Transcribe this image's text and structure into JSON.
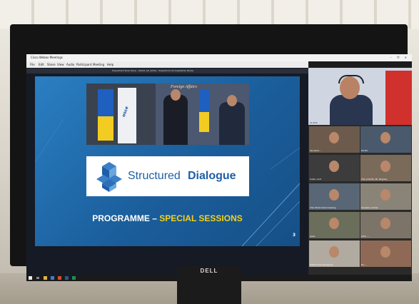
{
  "window": {
    "title": "Cisco Webex Meetings",
    "menu": [
      "File",
      "Edit",
      "Share",
      "View",
      "Audio",
      "Participant",
      "Meeting",
      "Help"
    ]
  },
  "presentation_window_title": "PowerPoint Slide Show - [OSCE_SD_2020] - PowerPoint (Compatibility Mode)",
  "slide": {
    "photo_caption": "Foreign Affairs",
    "logo_text_1": "Structured",
    "logo_text_2": "Dialogue",
    "footer_part1": "PROGRAMME – ",
    "footer_part2": "SPECIAL SESSIONS",
    "page_number": "3",
    "osce_text": "osce"
  },
  "video_panel": {
    "main_label": "AL-EUS",
    "tiles": [
      "Yes-Yeah...",
      "EU-EU",
      "Cuba, Lord",
      "USA (OSCE), Mr. Bogdan",
      "USA Strait-stand Galang",
      "Slovakia, Sorter",
      "Lada",
      "Adm. ...",
      "OSCE Joint Senuleries",
      "Hu..."
    ]
  },
  "monitor_brand": "DELL",
  "colors": {
    "slide_blue": "#1f6aa8",
    "footer_white": "#ffffff",
    "footer_yellow": "#f2d11b",
    "logo_blue": "#1d5fa6"
  }
}
